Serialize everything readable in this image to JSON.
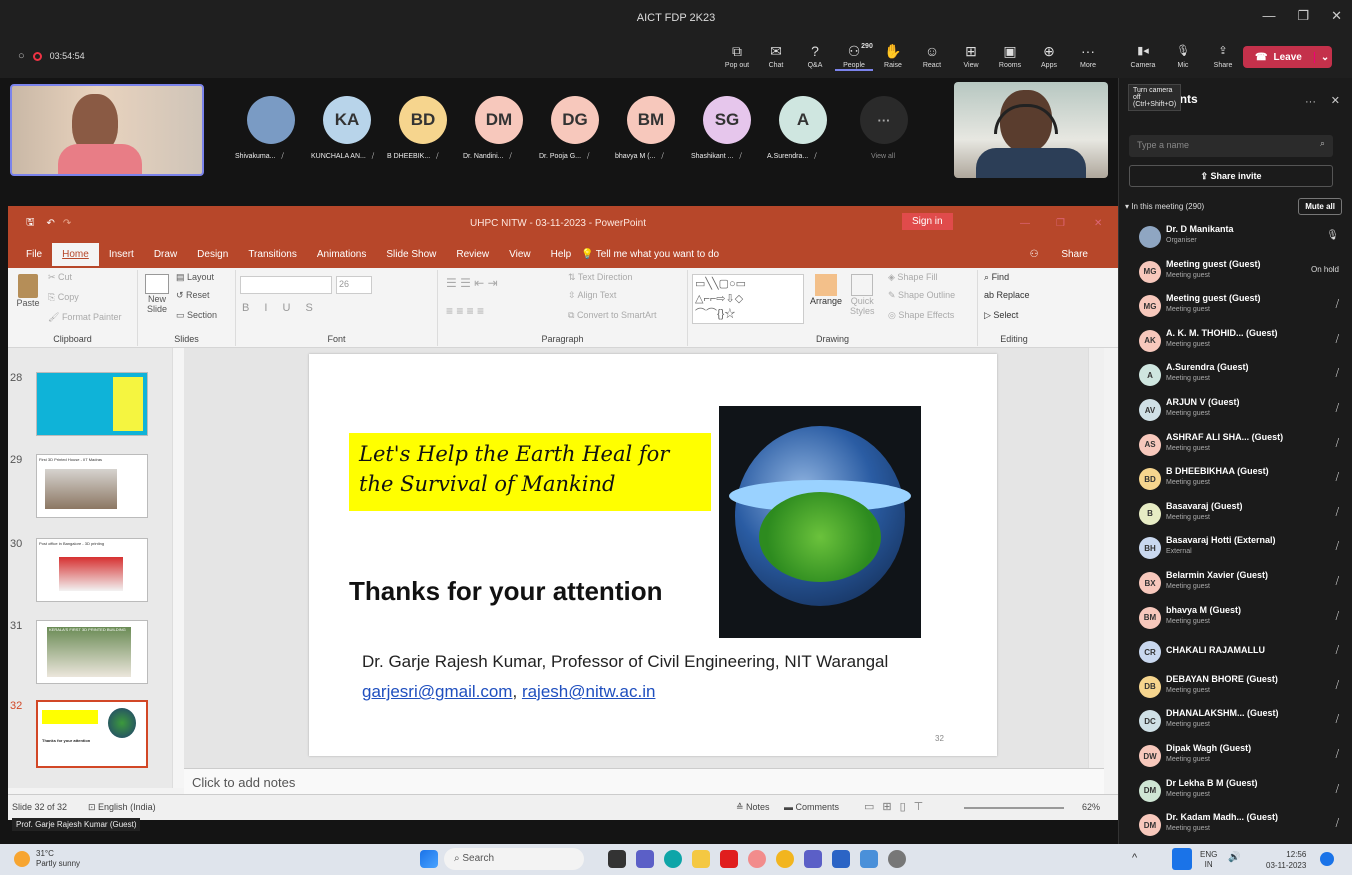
{
  "window": {
    "title": "AICT FDP 2K23"
  },
  "meeting": {
    "timer": "03:54:54",
    "tooltip": "Turn camera off (Ctrl+Shift+O)",
    "leave": "Leave"
  },
  "toolbar": [
    {
      "label": "Pop out",
      "icon": "popout-icon"
    },
    {
      "label": "Chat",
      "icon": "chat-icon"
    },
    {
      "label": "Q&A",
      "icon": "qa-icon"
    },
    {
      "label": "People",
      "icon": "people-icon",
      "badge": "290"
    },
    {
      "label": "Raise",
      "icon": "hand-icon"
    },
    {
      "label": "React",
      "icon": "smile-icon"
    },
    {
      "label": "View",
      "icon": "grid-icon"
    },
    {
      "label": "Rooms",
      "icon": "rooms-icon"
    },
    {
      "label": "Apps",
      "icon": "plus-icon"
    },
    {
      "label": "More",
      "icon": "more-icon"
    }
  ],
  "devices": [
    {
      "label": "Camera"
    },
    {
      "label": "Mic"
    },
    {
      "label": "Share"
    }
  ],
  "gallery": [
    {
      "initials": "",
      "name": "Shivakuma...",
      "color": "#7a9bc4"
    },
    {
      "initials": "KA",
      "name": "KUNCHALA AN...",
      "color": "#b8d4ea"
    },
    {
      "initials": "BD",
      "name": "B DHEEBIK...",
      "color": "#f6d58e"
    },
    {
      "initials": "DM",
      "name": "Dr. Nandini...",
      "color": "#f7c8bc"
    },
    {
      "initials": "DG",
      "name": "Dr. Pooja G...",
      "color": "#f7c8bc"
    },
    {
      "initials": "BM",
      "name": "bhavya M (...",
      "color": "#f7c8bc"
    },
    {
      "initials": "SG",
      "name": "Shashikant ...",
      "color": "#e6c6ec"
    },
    {
      "initials": "A",
      "name": "A.Surendra...",
      "color": "#cfe6e0"
    }
  ],
  "gallery_more": "View all",
  "ppt": {
    "title": "UHPC NITW - 03-11-2023 - PowerPoint",
    "signin": "Sign in",
    "menu": [
      "File",
      "Home",
      "Insert",
      "Draw",
      "Design",
      "Transitions",
      "Animations",
      "Slide Show",
      "Review",
      "View",
      "Help"
    ],
    "tellme": "Tell me what you want to do",
    "share": "Share",
    "groups": [
      "Clipboard",
      "Slides",
      "Font",
      "Paragraph",
      "Drawing",
      "Editing"
    ],
    "clip": {
      "paste": "Paste",
      "cut": "Cut",
      "copy": "Copy",
      "painter": "Format Painter"
    },
    "slidesgrp": {
      "new": "New",
      "slide": "Slide",
      "layout": "Layout",
      "reset": "Reset",
      "section": "Section"
    },
    "fontsize": "26",
    "para": {
      "dir": "Text Direction",
      "align": "Align Text",
      "smart": "Convert to SmartArt"
    },
    "draw": {
      "arrange": "Arrange",
      "quick": "Quick",
      "styles": "Styles",
      "fill": "Shape Fill",
      "outline": "Shape Outline",
      "effects": "Shape Effects"
    },
    "edit": {
      "find": "Find",
      "replace": "Replace",
      "select": "Select"
    },
    "slide_numbers": [
      "28",
      "29",
      "30",
      "31",
      "32"
    ],
    "thumb_texts": {
      "s29": "First 3D Printed House - IIT Madras",
      "s30": "Post office in Bangalore - 3D printing",
      "s31": "KERALA'S FIRST 3D PRINTED BUILDING"
    },
    "slide": {
      "banner": "Let's Help the Earth Heal for the Survival of Mankind",
      "thanks": "Thanks for your attention",
      "author": "Dr. Garje Rajesh Kumar, Professor of Civil Engineering, NIT Warangal",
      "email1": "garjesri@gmail.com",
      "sep": ",",
      "email2": "rajesh@nitw.ac.in",
      "number": "32"
    },
    "notes": "Click to add notes",
    "status": {
      "slide": "Slide 32 of 32",
      "lang": "English (India)",
      "notes": "Notes",
      "comments": "Comments",
      "zoom": "62%"
    }
  },
  "presenter": "Prof. Garje Rajesh Kumar (Guest)",
  "panel": {
    "title": "Participants",
    "search": "Type a name",
    "share_invite": "Share invite",
    "section": "In this meeting (290)",
    "mute_all": "Mute all",
    "people": [
      {
        "initials": "",
        "name": "Dr. D Manikanta",
        "sub": "Organiser",
        "right": "🎙",
        "color": "#8fa6c2"
      },
      {
        "initials": "MG",
        "name": "Meeting guest (Guest)",
        "sub": "Meeting guest",
        "right": "On hold",
        "color": "#f7c8bc"
      },
      {
        "initials": "MG",
        "name": "Meeting guest (Guest)",
        "sub": "Meeting guest",
        "right": "",
        "color": "#f7c8bc"
      },
      {
        "initials": "AK",
        "name": "A. K. M. THOHID... (Guest)",
        "sub": "Meeting guest",
        "right": "",
        "color": "#f7c8bc"
      },
      {
        "initials": "A",
        "name": "A.Surendra (Guest)",
        "sub": "Meeting guest",
        "right": "",
        "color": "#cfe6e0"
      },
      {
        "initials": "AV",
        "name": "ARJUN V (Guest)",
        "sub": "Meeting guest",
        "right": "",
        "color": "#cfe0e6"
      },
      {
        "initials": "AS",
        "name": "ASHRAF ALI SHA... (Guest)",
        "sub": "Meeting guest",
        "right": "",
        "color": "#f7c8bc"
      },
      {
        "initials": "BD",
        "name": "B DHEEBIKHAA (Guest)",
        "sub": "Meeting guest",
        "right": "",
        "color": "#f6d58e"
      },
      {
        "initials": "B",
        "name": "Basavaraj (Guest)",
        "sub": "Meeting guest",
        "right": "",
        "color": "#e7ecc4"
      },
      {
        "initials": "BH",
        "name": "Basavaraj Hotti (External)",
        "sub": "External",
        "right": "",
        "color": "#c9d8ef"
      },
      {
        "initials": "BX",
        "name": "Belarmin Xavier (Guest)",
        "sub": "Meeting guest",
        "right": "",
        "color": "#f7c8bc"
      },
      {
        "initials": "BM",
        "name": "bhavya M (Guest)",
        "sub": "Meeting guest",
        "right": "",
        "color": "#f7c8bc"
      },
      {
        "initials": "CR",
        "name": "CHAKALI RAJAMALLU",
        "sub": "",
        "right": "",
        "color": "#c9d8ef"
      },
      {
        "initials": "DB",
        "name": "DEBAYAN BHORE (Guest)",
        "sub": "Meeting guest",
        "right": "",
        "color": "#f6d58e"
      },
      {
        "initials": "DC",
        "name": "DHANALAKSHM... (Guest)",
        "sub": "Meeting guest",
        "right": "",
        "color": "#cfe0e6"
      },
      {
        "initials": "DW",
        "name": "Dipak Wagh (Guest)",
        "sub": "Meeting guest",
        "right": "",
        "color": "#f7c8bc"
      },
      {
        "initials": "DM",
        "name": "Dr Lekha B M (Guest)",
        "sub": "Meeting guest",
        "right": "",
        "color": "#cfe6d4"
      },
      {
        "initials": "DM",
        "name": "Dr. Kadam Madh... (Guest)",
        "sub": "Meeting guest",
        "right": "",
        "color": "#f7c8bc"
      }
    ]
  },
  "taskbar": {
    "temp": "31°C",
    "weather": "Partly sunny",
    "search": "Search",
    "lang1": "ENG",
    "lang2": "IN",
    "time": "12:56",
    "date": "03-11-2023"
  }
}
